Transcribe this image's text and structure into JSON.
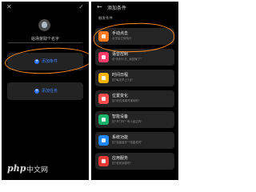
{
  "left_screen": {
    "close_label": "✕",
    "confirm_label": "✓",
    "scene_name": "给场景取个名字",
    "add_condition_label": "添加条件",
    "add_task_label": "添加任务",
    "add_glyph": "+"
  },
  "right_screen": {
    "back_glyph": "←",
    "title": "添加条件",
    "section_label": "触发条件",
    "options": [
      {
        "title": "手动点击",
        "desc": "点击后立即执行",
        "icon": "hand-tap-icon",
        "color": "#ff7a1f"
      },
      {
        "title": "语音控制",
        "desc": "说\"你好小艺, 我回家了\"",
        "icon": "voice-icon",
        "color": "#ff3b6b"
      },
      {
        "title": "时间日程",
        "desc": "如\"每天早上7点\"",
        "icon": "clock-icon",
        "color": "#f5b400"
      },
      {
        "title": "位置变化",
        "desc": "如\"到达或离开某地时\"",
        "icon": "location-icon",
        "color": "#ff4d4d"
      },
      {
        "title": "智能设备",
        "desc": "如\"开门时\"\"有人经过时\"",
        "icon": "smart-device-icon",
        "color": "#19b36b"
      },
      {
        "title": "系统功能",
        "desc": "如\"连接蓝牙\"\"电量低时\"",
        "icon": "system-icon",
        "color": "#1e88ff"
      },
      {
        "title": "应用服务",
        "desc": "如\"收到消息时\"",
        "icon": "app-service-icon",
        "color": "#e53935"
      }
    ]
  },
  "watermark": {
    "prefix": "php",
    "text": "中文网"
  }
}
